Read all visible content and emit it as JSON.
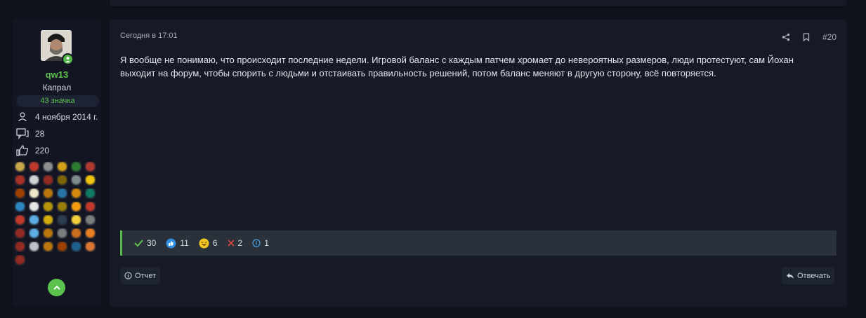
{
  "user": {
    "username": "qw13",
    "rank": "Капрал",
    "badges_count": "43 значка",
    "joined": "4 ноября 2014 г.",
    "messages": "28",
    "likes": "220",
    "badge_colors": [
      "#c9a84a",
      "#c0392b",
      "#8e8e8e",
      "#d4a017",
      "#2e7d32",
      "#b03a2e",
      "#a93226",
      "#d0d3d4",
      "#922b21",
      "#7d6608",
      "#7f8c8d",
      "#f1c40f",
      "#a04000",
      "#f0e6c8",
      "#b9770e",
      "#2874a6",
      "#d68910",
      "#117a65",
      "#2e86c1",
      "#e6e6e6",
      "#b7950b",
      "#9a7d0a",
      "#f39c12",
      "#c0392b",
      "#c0392b",
      "#5dade2",
      "#d4ac0d",
      "#2c3e50",
      "#f4d03f",
      "#7b7d7d",
      "#922b21",
      "#5dade2",
      "#b9770e",
      "#7b7d7d",
      "#ca6f1e",
      "#e67e22",
      "#922b21",
      "#bdc3c7",
      "#b9770e",
      "#a04000",
      "#1f618d",
      "#dc7633",
      "#922b21"
    ]
  },
  "post": {
    "date": "Сегодня в 17:01",
    "number": "#20",
    "text": "Я вообще не понимаю, что происходит последние недели. Игровой баланс с каждым патчем хромает до невероятных размеров, люди протестуют, сам Йохан выходит на форум, чтобы спорить с людьми и отстаивать правильность решений, потом баланс меняют в другую сторону, всё повторяется.",
    "accent_color": "#54b948"
  },
  "reactions": [
    {
      "icon": "check-icon",
      "count": "30",
      "color": "#5bc24d"
    },
    {
      "icon": "thumbs-up-icon",
      "count": "11",
      "color": "#2f8ee0"
    },
    {
      "icon": "laugh-icon",
      "count": "6",
      "color": "#f3c623"
    },
    {
      "icon": "cross-icon",
      "count": "2",
      "color": "#e0443e"
    },
    {
      "icon": "info-icon",
      "count": "1",
      "color": "#4aa3e8"
    }
  ],
  "buttons": {
    "report": "Отчет",
    "reply": "Отвечать"
  }
}
